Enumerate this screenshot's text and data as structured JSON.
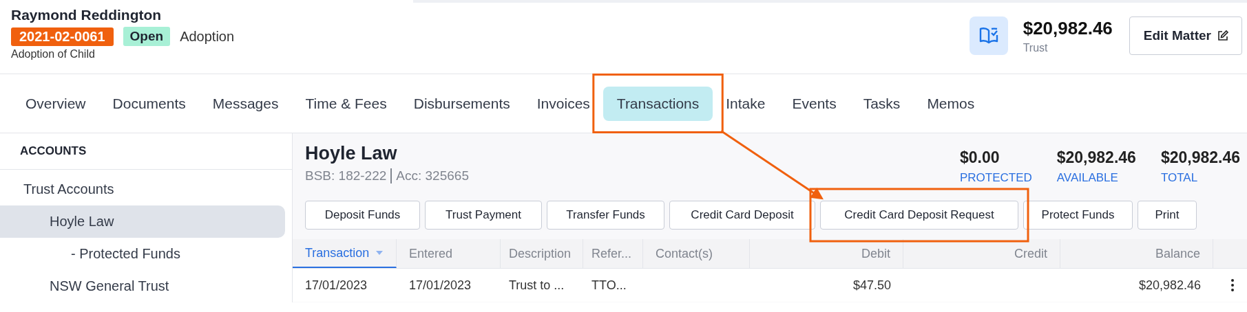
{
  "matter": {
    "client": "Raymond Reddington",
    "number": "2021-02-0061",
    "status": "Open",
    "type": "Adoption",
    "description": "Adoption of Child"
  },
  "trust": {
    "amount": "$20,982.46",
    "label": "Trust"
  },
  "edit_button": "Edit Matter",
  "tabs": [
    {
      "label": "Overview",
      "selected": false,
      "highlighted": false
    },
    {
      "label": "Documents",
      "selected": false,
      "highlighted": false
    },
    {
      "label": "Messages",
      "selected": false,
      "highlighted": false
    },
    {
      "label": "Time & Fees",
      "selected": false,
      "highlighted": false
    },
    {
      "label": "Disbursements",
      "selected": false,
      "highlighted": false
    },
    {
      "label": "Invoices",
      "selected": false,
      "highlighted": false
    },
    {
      "label": "Transactions",
      "selected": true,
      "highlighted": true
    },
    {
      "label": "Intake",
      "selected": false,
      "highlighted": false
    },
    {
      "label": "Events",
      "selected": false,
      "highlighted": false
    },
    {
      "label": "Tasks",
      "selected": false,
      "highlighted": false
    },
    {
      "label": "Memos",
      "selected": false,
      "highlighted": false
    }
  ],
  "sidebar": {
    "heading": "ACCOUNTS",
    "items": [
      {
        "label": "Trust Accounts",
        "selected": false,
        "children": [
          {
            "label": "Hoyle Law",
            "selected": true,
            "children": [
              {
                "label": "- Protected Funds",
                "selected": false
              }
            ]
          },
          {
            "label": "NSW General Trust",
            "selected": false
          }
        ]
      }
    ]
  },
  "account": {
    "name": "Hoyle Law",
    "bsb": "BSB: 182-222",
    "acc": "Acc: 325665",
    "totals": [
      {
        "amount": "$0.00",
        "label": "PROTECTED"
      },
      {
        "amount": "$20,982.46",
        "label": "AVAILABLE"
      },
      {
        "amount": "$20,982.46",
        "label": "TOTAL"
      }
    ]
  },
  "actions": [
    {
      "label": "Deposit Funds",
      "highlighted": false
    },
    {
      "label": "Trust Payment",
      "highlighted": false
    },
    {
      "label": "Transfer Funds",
      "highlighted": false
    },
    {
      "label": "Credit Card Deposit",
      "highlighted": false
    },
    {
      "label": "Credit Card Deposit Request",
      "highlighted": true
    },
    {
      "label": "Protect Funds",
      "highlighted": false
    },
    {
      "label": "Print",
      "highlighted": false
    }
  ],
  "table": {
    "columns": [
      {
        "label": "Transaction",
        "kind": "text",
        "sorted": true
      },
      {
        "label": "Entered",
        "kind": "text",
        "sorted": false
      },
      {
        "label": "Description",
        "kind": "text",
        "sorted": false
      },
      {
        "label": "Refer...",
        "kind": "text",
        "sorted": false
      },
      {
        "label": "Contact(s)",
        "kind": "text",
        "sorted": false
      },
      {
        "label": "Debit",
        "kind": "money",
        "sorted": false
      },
      {
        "label": "Credit",
        "kind": "money",
        "sorted": false
      },
      {
        "label": "Balance",
        "kind": "money",
        "sorted": false
      }
    ],
    "rows": [
      {
        "cells": [
          "17/01/2023",
          "17/01/2023",
          "Trust to ...",
          "TTO...",
          "",
          "$47.50",
          "",
          "$20,982.46"
        ]
      }
    ]
  }
}
